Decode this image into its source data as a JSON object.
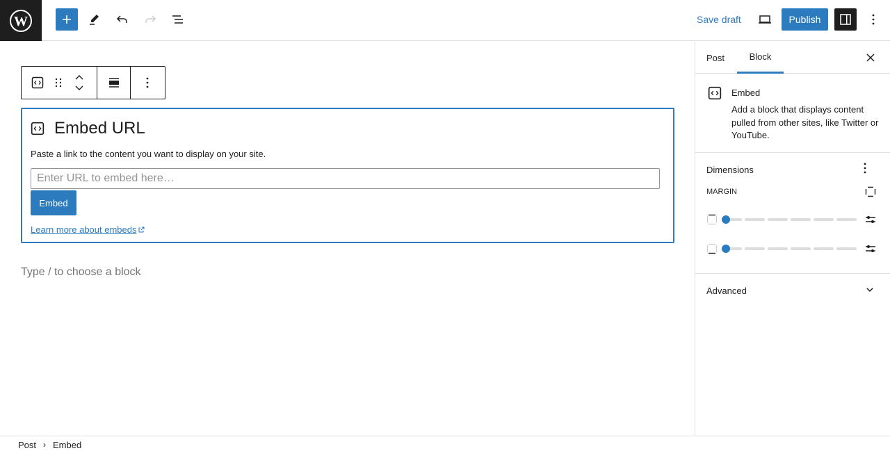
{
  "topbar": {
    "logo": "wordpress-logo",
    "inserter_icon": "plus-icon",
    "tools_icon": "pencil-icon",
    "undo_icon": "undo-icon",
    "redo_icon": "redo-icon",
    "list_view_icon": "list-view-icon",
    "save_draft_label": "Save draft",
    "preview_icon": "desktop-icon",
    "publish_label": "Publish",
    "settings_icon": "sidebar-icon",
    "options_icon": "more-vertical-icon"
  },
  "block_toolbar": {
    "block_icon": "embed-icon",
    "drag_icon": "drag-handle-icon",
    "move_up_icon": "chevron-up-icon",
    "move_down_icon": "chevron-down-icon",
    "align_icon": "align-icon",
    "options_icon": "more-vertical-icon"
  },
  "embed": {
    "title": "Embed URL",
    "instructions": "Paste a link to the content you want to display on your site.",
    "input_value": "",
    "input_placeholder": "Enter URL to embed here…",
    "button_label": "Embed",
    "learn_more": "Learn more about embeds",
    "learn_more_icon": "external-link-icon"
  },
  "appender_placeholder": "Type / to choose a block",
  "sidebar": {
    "tabs": [
      {
        "label": "Post",
        "active": false
      },
      {
        "label": "Block",
        "active": true
      }
    ],
    "close_icon": "close-icon",
    "block_card": {
      "title": "Embed",
      "description": "Add a block that displays content pulled from other sites, like Twitter or YouTube."
    },
    "dimensions": {
      "title": "Dimensions",
      "margin_label": "MARGIN",
      "ranges": [
        {
          "side": "top",
          "value": 0,
          "steps": 6
        },
        {
          "side": "bottom",
          "value": 0,
          "steps": 6
        }
      ]
    },
    "advanced": {
      "title": "Advanced",
      "expanded": false
    }
  },
  "breadcrumb": [
    "Post",
    "Embed"
  ],
  "colors": {
    "accent": "#2c7bbf",
    "dark": "#1e1e1e",
    "border": "#e0e0e0",
    "placeholder": "#757575"
  }
}
